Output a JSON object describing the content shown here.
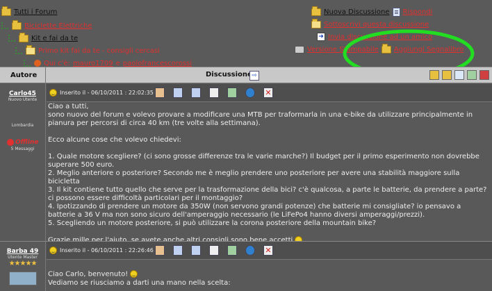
{
  "breadcrumb": {
    "items": [
      {
        "label": "Tutti i Forum"
      },
      {
        "label": "Biciclette Elettriche"
      },
      {
        "label": "Kit e fai da te"
      },
      {
        "label": "Primo kit fai da te - consigli cercasi"
      }
    ],
    "online_prefix": "Qui c'è:",
    "online_users": [
      "mauro1709",
      "paolofrancescorossi"
    ],
    "online_sep": "e"
  },
  "actions": {
    "new_discussion": "Nuova Discussione",
    "reply": "Rispondi",
    "subscribe": "Sottoscrivi questa discussione",
    "send_to_friend": "Invia discussione ad un amico",
    "printable": "Versione Stampabile",
    "bookmark": "Aggiungi Segnalibro"
  },
  "table": {
    "col_author": "Autore",
    "col_discussion": "Discussione"
  },
  "posts": [
    {
      "author": "Carlo45",
      "rank": "Nuovo Utente",
      "location": "Lombardia",
      "status": "Offline",
      "messages": "5 Messaggi",
      "inserted": "Inserito il - 06/10/2011 : 22:02:35",
      "body": [
        "Ciao a tutti,",
        "sono nuovo del forum e volevo provare a modificare una MTB per traformarla in una e-bike da utilizzare principalmente in pianura per percorsi di circa 40 km (tre volte alla settimana).",
        "",
        "Ecco alcune cose che volevo chiedevi:",
        "",
        "1. Quale motore scegliere? (ci sono grosse differenze tra le varie marche?) Il budget per il primo esperimento non dovrebbe superare 500 euro.",
        "2. Meglio anteriore o posteriore? Secondo me è meglio prendere uno posteriore per avere una stabilità maggiore sulla bicicletta",
        "3. Il kit contiene tutto quello che serve per la trasformazione della bici? c'è qualcosa, a parte le batterie, da prendere a parte? ci possono essere difficoltà particolari per il montaggio?",
        "4. Ipotizzando di prendere un motore da 350W (non servono grandi potenze) che batterie mi consigliate? io pensavo a batterie a 36 V ma non sono sicuro dell'amperaggio necessario (le LiFePo4 hanno diversi amperaggi/prezzi).",
        "5. Scegliendo un motore posteriore, si può utilizzare la corona posteriore della mountain bike?",
        "",
        "Grazie mille per l'aiuto, se avete anche altri consigli sono bene accetti"
      ]
    },
    {
      "author": "Barba 49",
      "rank": "Utente Master",
      "inserted": "Inserito il - 06/10/2011 : 22:26:46",
      "body": [
        "Ciao Carlo, benvenuto!",
        "Vediamo se riusciamo a darti una mano nella scelta:"
      ]
    }
  ],
  "colors": {
    "background": "#5a5a5a",
    "link_red": "#e03030",
    "header_gray": "#c8c8c8",
    "highlight_green": "#22dd22"
  }
}
